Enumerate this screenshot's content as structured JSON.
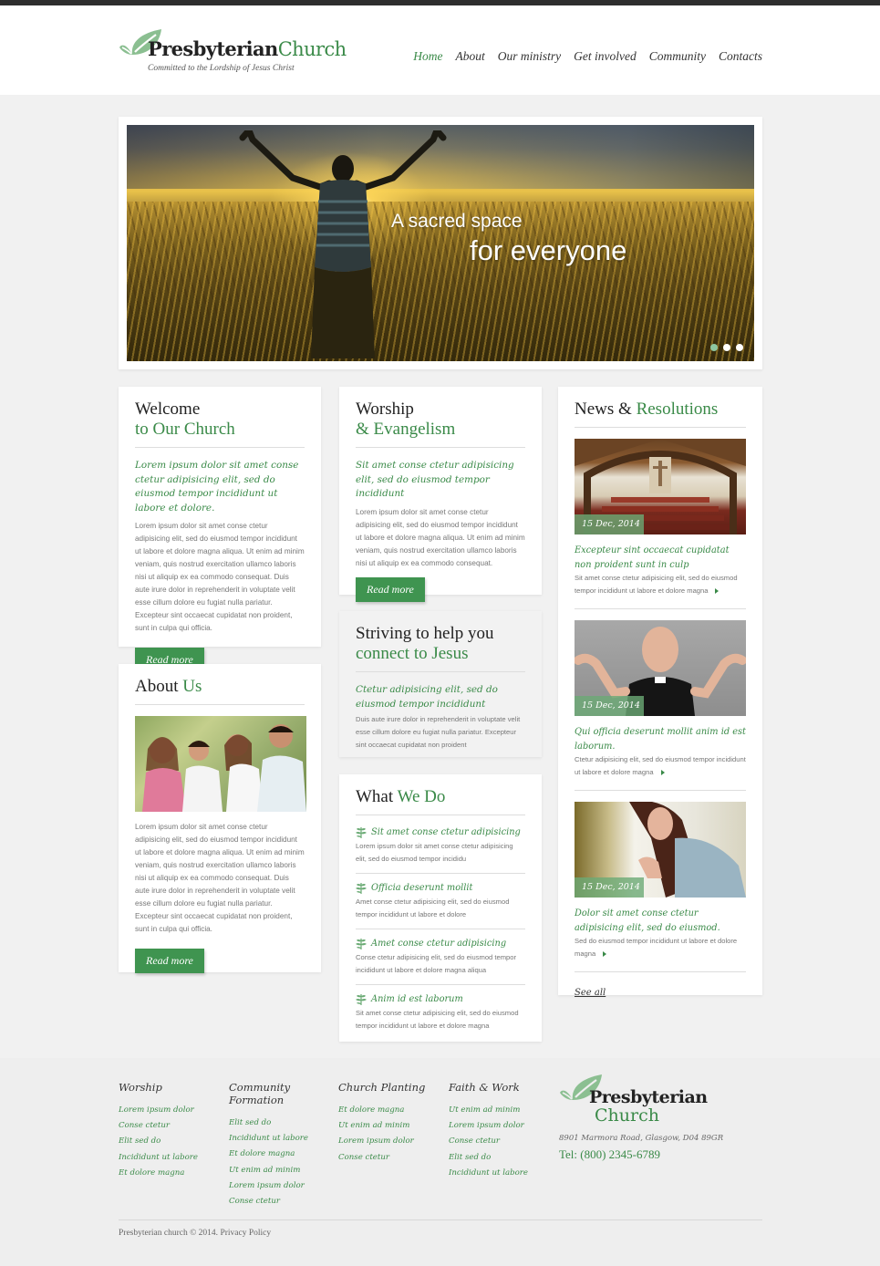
{
  "brand": {
    "name_main": "Presbyterian",
    "name_accent": "Church",
    "tagline": "Committed to the Lordship of Jesus Christ"
  },
  "colors": {
    "accent_green": "#3a8a48",
    "button_green": "#3f9450",
    "topbar": "#2e2e2e",
    "background": "#f1f1f1"
  },
  "nav": {
    "items": [
      {
        "label": "Home",
        "active": true
      },
      {
        "label": "About"
      },
      {
        "label": "Our ministry"
      },
      {
        "label": "Get involved"
      },
      {
        "label": "Community"
      },
      {
        "label": "Contacts"
      }
    ]
  },
  "slider": {
    "caption_line1": "A sacred space",
    "caption_line2": "for everyone",
    "slide_count": 3,
    "active_slide": 1
  },
  "welcome": {
    "title_dark": "Welcome",
    "title_green": "to Our Church",
    "lead": "Lorem ipsum dolor sit amet conse ctetur adipisicing elit, sed do eiusmod tempor incididunt ut labore et dolore.",
    "body": "Lorem ipsum dolor sit amet conse ctetur adipisicing elit, sed do eiusmod tempor incididunt ut labore et dolore magna aliqua. Ut enim ad minim veniam, quis nostrud exercitation ullamco laboris nisi ut aliquip ex ea commodo consequat. Duis aute irure dolor in reprehenderit in voluptate velit esse cillum dolore eu fugiat nulla pariatur. Excepteur sint occaecat cupidatat non proident, sunt in culpa qui officia.",
    "button": "Read more"
  },
  "about": {
    "title_dark": "About",
    "title_green": "Us",
    "body": "Lorem ipsum dolor sit amet conse ctetur adipisicing elit, sed do eiusmod tempor incididunt ut labore et dolore magna aliqua. Ut enim ad minim veniam, quis nostrud exercitation ullamco laboris nisi ut aliquip ex ea commodo consequat. Duis aute irure dolor in reprehenderit in voluptate velit esse cillum dolore eu fugiat nulla pariatur. Excepteur sint occaecat cupidatat non proident, sunt in culpa qui officia.",
    "button": "Read more"
  },
  "worship": {
    "title_dark": "Worship",
    "title_green": "& Evangelism",
    "lead": "Sit amet conse ctetur adipisicing elit, sed do eiusmod tempor incididunt",
    "body": "Lorem ipsum dolor sit amet conse ctetur adipisicing elit, sed do eiusmod tempor incididunt ut labore et dolore magna aliqua. Ut enim ad minim veniam, quis nostrud exercitation ullamco laboris nisi ut aliquip ex ea commodo consequat.",
    "button": "Read more"
  },
  "striving": {
    "title_dark": "Striving to help you",
    "title_green": "connect to Jesus",
    "lead": "Ctetur adipisicing elit, sed do eiusmod tempor incididunt",
    "body": "Duis aute irure dolor in reprehenderit in voluptate velit esse cillum dolore eu fugiat nulla pariatur. Excepteur sint occaecat cupidatat non proident"
  },
  "what_we_do": {
    "title_dark": "What",
    "title_green": "We Do",
    "items": [
      {
        "title": "Sit amet conse ctetur adipisicing",
        "body": "Lorem ipsum dolor sit amet conse ctetur adipisicing elit, sed do eiusmod tempor incididu"
      },
      {
        "title": "Officia deserunt mollit",
        "body": "Amet conse ctetur adipisicing elit, sed do eiusmod tempor incididunt ut labore et dolore"
      },
      {
        "title": "Amet conse ctetur adipisicing",
        "body": "Conse ctetur adipisicing elit, sed do eiusmod tempor incididunt ut labore et dolore magna aliqua"
      },
      {
        "title": "Anim id est laborum",
        "body": "Sit amet conse ctetur adipisicing elit, sed do eiusmod tempor incididunt ut labore et dolore magna"
      }
    ]
  },
  "news": {
    "title_dark": "News &",
    "title_green": "Resolutions",
    "items": [
      {
        "date": "15 Dec, 2014",
        "title": "Excepteur sint occaecat cupidatat non proident sunt in culp",
        "body": "Sit amet conse ctetur adipisicing elit, sed do eiusmod tempor incididunt ut labore et dolore magna"
      },
      {
        "date": "15 Dec, 2014",
        "title": "Qui officia deserunt mollit anim id est laborum.",
        "body": "Ctetur adipisicing elit, sed do eiusmod tempor incididunt ut labore et dolore magna"
      },
      {
        "date": "15 Dec, 2014",
        "title": "Dolor sit amet conse ctetur adipisicing elit, sed do eiusmod.",
        "body": "Sed do eiusmod tempor incididunt ut labore et dolore magna"
      }
    ],
    "see_all": "See all"
  },
  "footer": {
    "columns": [
      {
        "title": "Worship",
        "links": [
          "Lorem ipsum dolor",
          "Conse ctetur",
          "Elit sed do",
          "Incididunt ut labore",
          "Et dolore magna"
        ]
      },
      {
        "title": "Community Formation",
        "links": [
          "Elit sed do",
          "Incididunt ut labore",
          "Et dolore magna",
          "Ut enim ad minim",
          "Lorem ipsum dolor",
          "Conse ctetur"
        ]
      },
      {
        "title": "Church Planting",
        "links": [
          "Et dolore magna",
          "Ut enim ad minim",
          "Lorem ipsum dolor",
          "Conse ctetur"
        ]
      },
      {
        "title": "Faith & Work",
        "links": [
          "Ut enim ad minim",
          "Lorem ipsum dolor",
          "Conse ctetur",
          "Elit sed do",
          "Incididunt ut labore"
        ]
      }
    ],
    "logo_line1": "Presbyterian",
    "logo_line2": "Church",
    "address": "8901 Marmora Road, Glasgow, D04 89GR",
    "tel": "Tel: (800) 2345-6789",
    "copyright": "Presbyterian church © 2014.",
    "privacy": "Privacy Policy"
  }
}
